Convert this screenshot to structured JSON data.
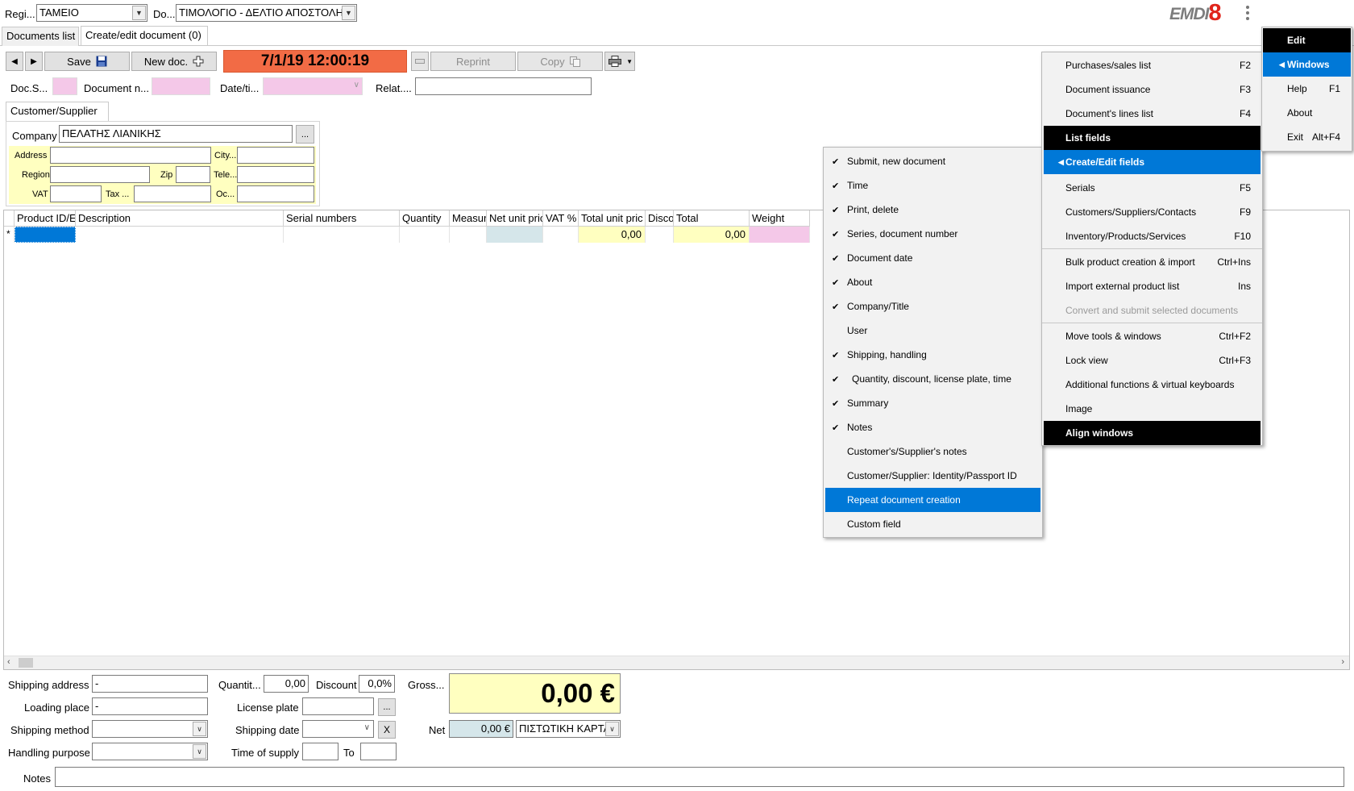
{
  "top": {
    "register_label": "Regi...",
    "register_value": "ΤΑΜΕΙΟ",
    "doc_label": "Do...",
    "doc_value": "ΤΙΜΟΛΟΓΙΟ - ΔΕΛΤΙΟ ΑΠΟΣΤΟΛΗΣ",
    "logo_text": "EMDI",
    "logo_num": "8",
    "more_icon": "vertical-dots-icon"
  },
  "tabs": [
    "Documents list",
    "Create/edit document (0)"
  ],
  "toolbar": {
    "prev_icon": "◀",
    "next_icon": "▶",
    "save_label": "Save",
    "new_label": "New doc.",
    "datetime": "7/1/19 12:00:19",
    "reprint_label": "Reprint",
    "copy_label": "Copy"
  },
  "header_fields": {
    "docs_label": "Doc.S...",
    "docnum_label": "Document n...",
    "date_label": "Date/ti...",
    "related_label": "Relat...."
  },
  "customer": {
    "tab_label": "Customer/Supplier",
    "company_label": "Company",
    "company_value": "ΠΕΛΑΤΗΣ ΛΙΑΝΙΚΗΣ",
    "browse": "...",
    "address_label": "Address",
    "city_label": "City...",
    "region_label": "Region",
    "zip_label": "Zip",
    "tele_label": "Tele...",
    "vat_label": "VAT",
    "tax_label": "Tax ...",
    "oc_label": "Oc..."
  },
  "grid": {
    "columns": [
      "Product ID/E",
      "Description",
      "Serial numbers",
      "Quantity",
      "Measur",
      "Net unit pric",
      "VAT %",
      "Total unit pric",
      "Disco",
      "Total",
      "Weight"
    ],
    "row_marker": "*",
    "total_unit_price": "0,00",
    "total": "0,00"
  },
  "bottom": {
    "shipping_address_label": "Shipping address",
    "shipping_address_value": "-",
    "loading_place_label": "Loading place",
    "loading_place_value": "-",
    "shipping_method_label": "Shipping method",
    "handling_purpose_label": "Handling purpose",
    "quantity_label": "Quantit...",
    "quantity_value": "0,00",
    "discount_label": "Discount",
    "discount_value": "0,0%",
    "license_plate_label": "License plate",
    "shipping_date_label": "Shipping date",
    "clear_label": "X",
    "time_of_supply_label": "Time of supply",
    "to_label": "To",
    "gross_label": "Gross...",
    "gross_value": "0,00 €",
    "net_label": "Net",
    "net_value": "0,00 €",
    "payment_value": "ΠΙΣΤΩΤΙΚΗ ΚΑΡΤΑ",
    "notes_label": "Notes",
    "browse": "..."
  },
  "menubar": {
    "items": [
      {
        "label": "Edit",
        "shortcut": ""
      },
      {
        "label": "Windows",
        "shortcut": ""
      },
      {
        "label": "Help",
        "shortcut": "F1"
      },
      {
        "label": "About",
        "shortcut": ""
      },
      {
        "label": "Exit",
        "shortcut": "Alt+F4"
      }
    ]
  },
  "windows_menu": {
    "items": [
      {
        "label": "Purchases/sales list",
        "shortcut": "F2"
      },
      {
        "label": "Document issuance",
        "shortcut": "F3"
      },
      {
        "label": "Document's lines list",
        "shortcut": "F4"
      },
      {
        "label": "List fields",
        "shortcut": ""
      },
      {
        "label": "Create/Edit fields",
        "shortcut": ""
      },
      {
        "label": "Serials",
        "shortcut": "F5"
      },
      {
        "label": "Customers/Suppliers/Contacts",
        "shortcut": "F9"
      },
      {
        "label": "Inventory/Products/Services",
        "shortcut": "F10"
      },
      {
        "label": "Bulk product creation & import",
        "shortcut": "Ctrl+Ins"
      },
      {
        "label": "Import external product list",
        "shortcut": "Ins"
      },
      {
        "label": "Convert and submit selected documents",
        "shortcut": ""
      },
      {
        "label": "Move tools & windows",
        "shortcut": "Ctrl+F2"
      },
      {
        "label": "Lock view",
        "shortcut": "Ctrl+F3"
      },
      {
        "label": "Additional functions & virtual keyboards",
        "shortcut": ""
      },
      {
        "label": "Image",
        "shortcut": ""
      },
      {
        "label": "Align windows",
        "shortcut": ""
      }
    ]
  },
  "fields_menu": {
    "items": [
      {
        "label": "Submit, new document",
        "checked": true
      },
      {
        "label": "Time",
        "checked": true
      },
      {
        "label": "Print, delete",
        "checked": true
      },
      {
        "label": "Series, document number",
        "checked": true
      },
      {
        "label": "Document date",
        "checked": true
      },
      {
        "label": "About",
        "checked": true
      },
      {
        "label": "Company/Title",
        "checked": true
      },
      {
        "label": "User",
        "checked": false
      },
      {
        "label": "Shipping, handling",
        "checked": true
      },
      {
        "label": "Quantity, discount, license plate, time",
        "checked": true
      },
      {
        "label": "Summary",
        "checked": true
      },
      {
        "label": "Notes",
        "checked": true
      },
      {
        "label": "Customer's/Supplier's notes",
        "checked": false
      },
      {
        "label": "Customer/Supplier: Identity/Passport ID",
        "checked": false
      },
      {
        "label": "Repeat document creation",
        "checked": false
      },
      {
        "label": "Custom field",
        "checked": false
      }
    ]
  },
  "colors": {
    "datetime_bg": "#f26b45",
    "pink": "#f4c8e8",
    "yellow": "#ffffc0",
    "light_blue": "#d5e6ea",
    "menu_blue": "#0078d7",
    "logo_red": "#e0251b"
  }
}
